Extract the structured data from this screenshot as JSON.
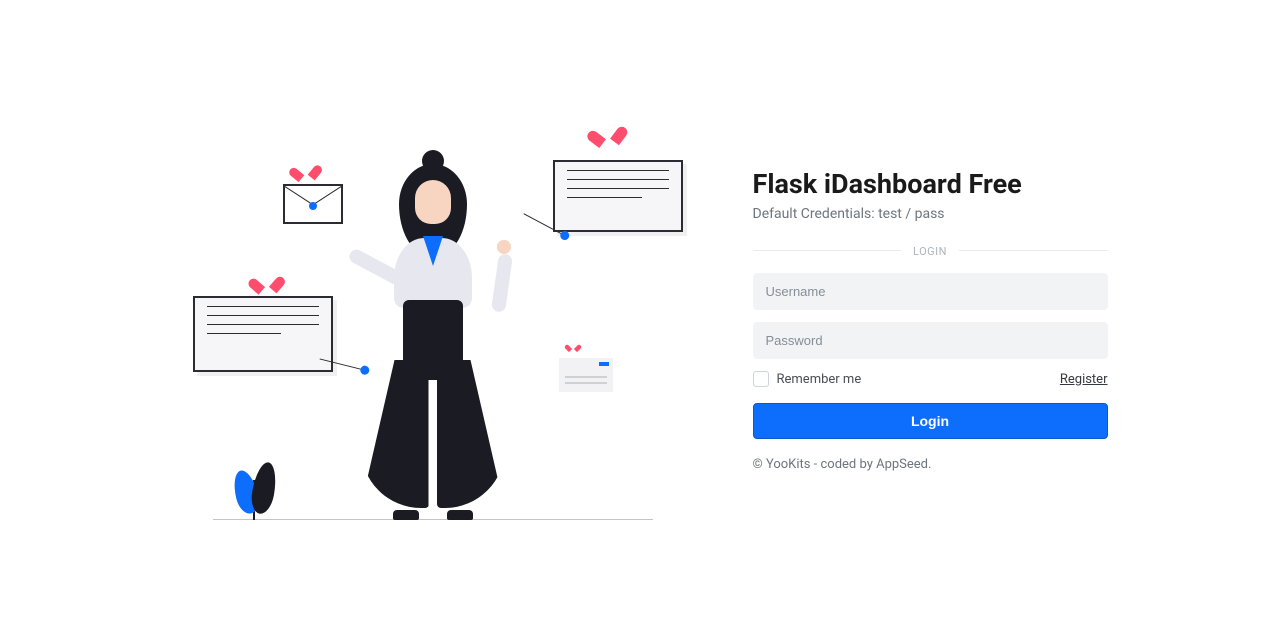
{
  "header": {
    "title": "Flask iDashboard Free",
    "subtitle": "Default Credentials: test / pass"
  },
  "form": {
    "divider_label": "LOGIN",
    "username_placeholder": "Username",
    "username_value": "",
    "password_placeholder": "Password",
    "password_value": "",
    "remember_label": "Remember me",
    "register_label": "Register",
    "submit_label": "Login"
  },
  "footer": {
    "text": "© YooKits - coded by AppSeed."
  }
}
